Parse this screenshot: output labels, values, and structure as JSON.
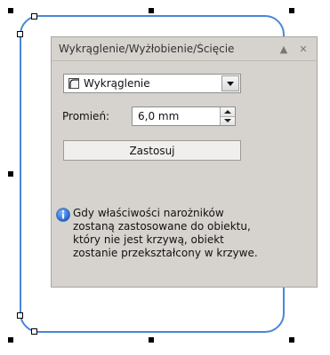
{
  "docker": {
    "title": "Wykrąglenie/Wyżłobienie/Ścięcie",
    "header_icons": [
      "collapse-up-icon",
      "close-icon"
    ],
    "corner_type": {
      "selected": "Wykrąglenie",
      "icon": "fillet-corner-icon"
    },
    "radius": {
      "label": "Promień:",
      "value": "6,0 mm"
    },
    "apply_button": "Zastosuj",
    "info": {
      "icon": "info-icon",
      "lines": [
        "Gdy właściwości narożników",
        "zostaną zastosowane do obiektu,",
        "który nie jest krzywą, obiekt",
        "zostanie przekształcony w krzywe."
      ]
    }
  },
  "canvas": {
    "outline_color": "#4a86d8",
    "accent_info": "#2f6fd3"
  }
}
